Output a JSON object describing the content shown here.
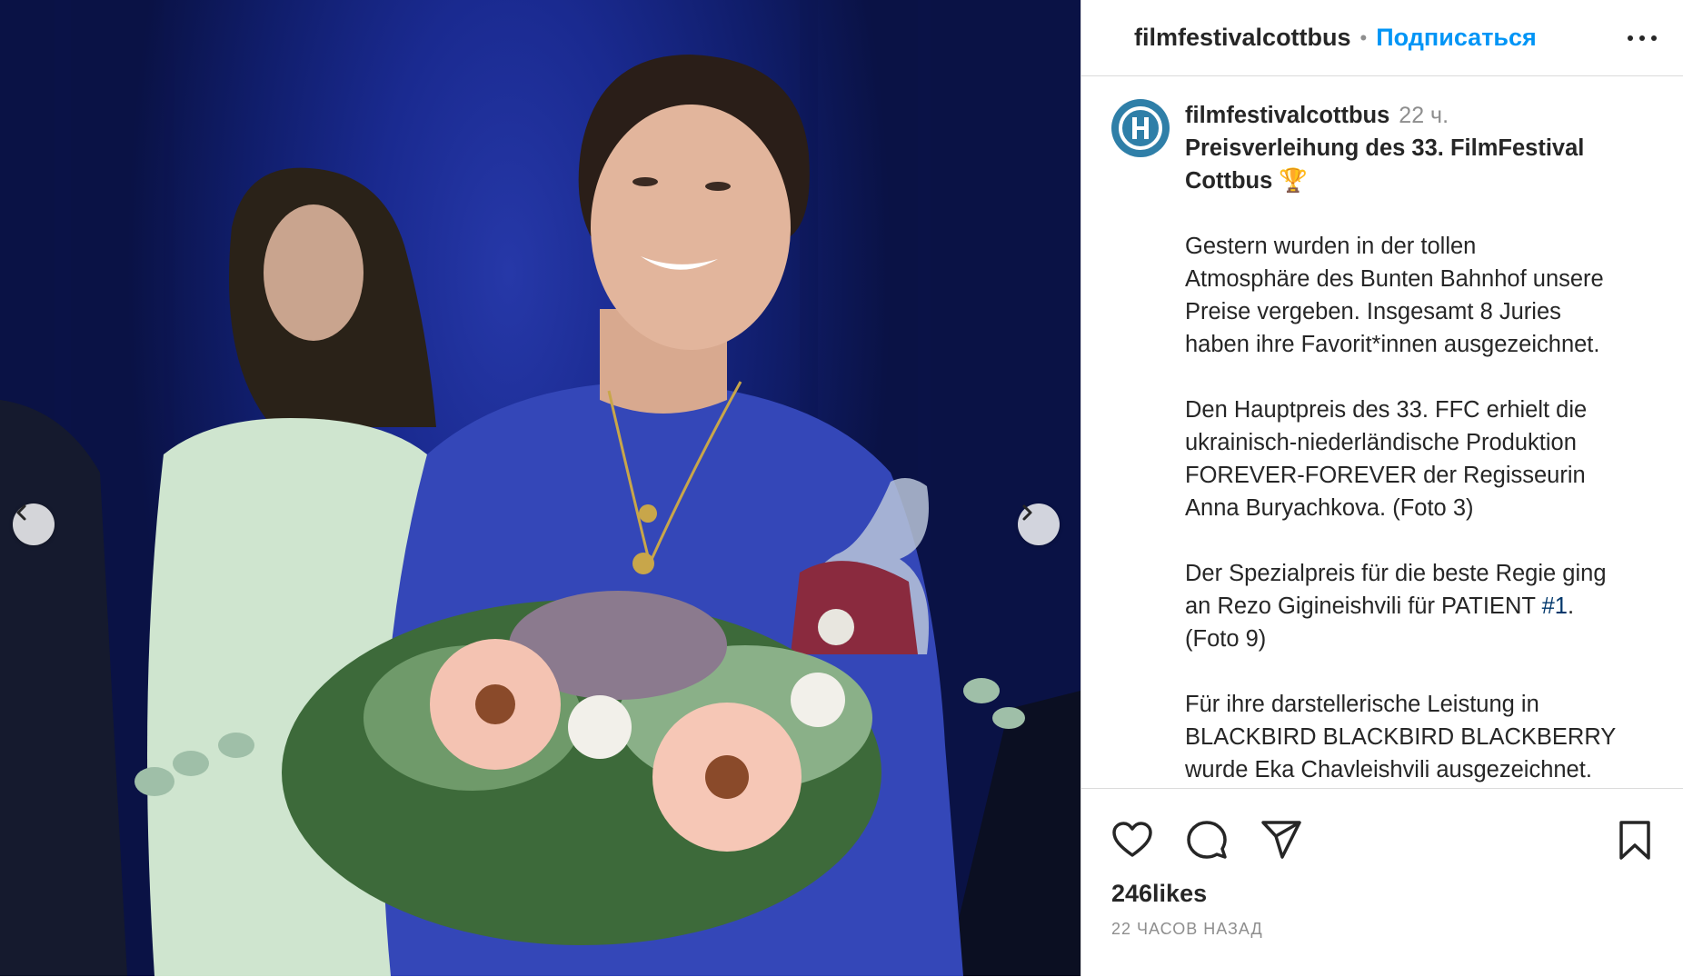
{
  "photo": {
    "description_icon": "award-ceremony-photo",
    "prev_icon": "chevron-left-icon",
    "next_icon": "chevron-right-icon"
  },
  "header": {
    "username": "filmfestivalcottbus",
    "separator": "•",
    "follow_label": "Подписаться",
    "more_icon": "more-options-icon"
  },
  "caption": {
    "username": "filmfestivalcottbus",
    "time": "22 ч.",
    "title_line1": "Preisverleihung des 33. FilmFestival",
    "title_line2": "Cottbus 🏆",
    "p1_l1": "Gestern wurden in der tollen",
    "p1_l2": "Atmosphäre des Bunten Bahnhof unsere",
    "p1_l3": "Preise vergeben. Insgesamt 8 Juries",
    "p1_l4": "haben ihre Favorit*innen ausgezeichnet.",
    "p2_l1": "Den Hauptpreis des 33. FFC erhielt die",
    "p2_l2": "ukrainisch-niederländische Produktion",
    "p2_l3": "FOREVER-FOREVER der Regisseurin",
    "p2_l4": "Anna Buryachkova. (Foto 3)",
    "p3_l1": "Der Spezialpreis für die beste Regie ging",
    "p3_l2_pre": "an Rezo Gigineishvili für PATIENT ",
    "p3_hashtag": "#1",
    "p3_l2_post": ".",
    "p3_l3": "(Foto 9)",
    "p4_l1": "Für ihre darstellerische Leistung in",
    "p4_l2": "BLACKBIRD BLACKBIRD BLACKBERRY",
    "p4_l3": "wurde Eka Chavleishvili ausgezeichnet."
  },
  "actions": {
    "like_icon": "heart-icon",
    "comment_icon": "comment-icon",
    "share_icon": "share-icon",
    "save_icon": "bookmark-icon",
    "likes": "246likes",
    "posted": "22 часов назад"
  },
  "colors": {
    "follow": "#0095f6",
    "hashtag": "#00376b",
    "muted": "#8e8e8e",
    "stage_blue": "#1a2a90"
  }
}
